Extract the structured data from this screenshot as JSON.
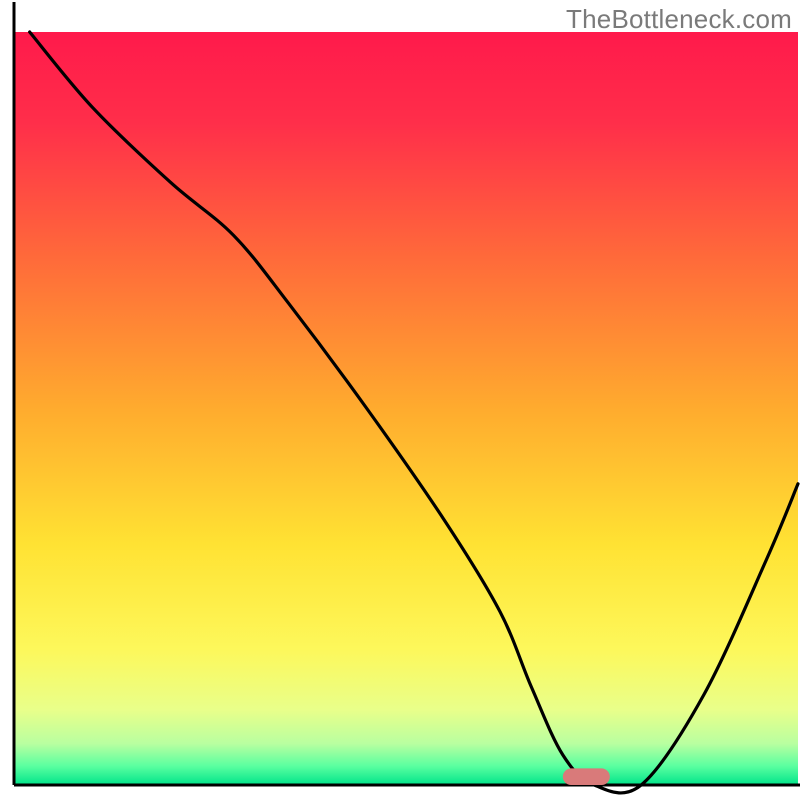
{
  "watermark": "TheBottleneck.com",
  "chart_data": {
    "type": "line",
    "title": "",
    "xlabel": "",
    "ylabel": "",
    "xlim": [
      0,
      100
    ],
    "ylim": [
      0,
      100
    ],
    "grid": false,
    "legend": false,
    "series": [
      {
        "name": "bottleneck-curve",
        "x": [
          2,
          10,
          20,
          28,
          35,
          45,
          55,
          62,
          66,
          70,
          74,
          80,
          88,
          96,
          100
        ],
        "y": [
          100,
          90,
          80,
          73,
          64,
          50,
          35,
          23,
          13,
          4,
          0,
          0,
          12,
          30,
          40
        ]
      }
    ],
    "marker": {
      "name": "optimal-range",
      "x_center": 73,
      "y": 0,
      "width": 6,
      "height": 2.2,
      "color": "#d97a7a"
    },
    "background_gradient": {
      "stops": [
        {
          "offset": 0.0,
          "color": "#ff1a4b"
        },
        {
          "offset": 0.12,
          "color": "#ff2e4a"
        },
        {
          "offset": 0.3,
          "color": "#ff6a3a"
        },
        {
          "offset": 0.5,
          "color": "#ffab2e"
        },
        {
          "offset": 0.68,
          "color": "#ffe233"
        },
        {
          "offset": 0.82,
          "color": "#fdf85b"
        },
        {
          "offset": 0.9,
          "color": "#e9ff8a"
        },
        {
          "offset": 0.945,
          "color": "#b9ffa0"
        },
        {
          "offset": 0.975,
          "color": "#5affa0"
        },
        {
          "offset": 1.0,
          "color": "#00e48a"
        }
      ]
    },
    "axes_color": "#000000",
    "curve_color": "#000000",
    "curve_width": 3.2
  }
}
